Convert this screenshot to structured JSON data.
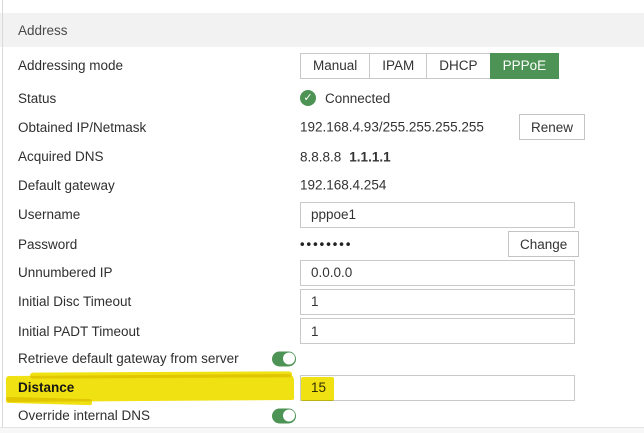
{
  "section_title": "Address",
  "icons": {
    "check": "✓"
  },
  "colors": {
    "green": "#4c9355",
    "highlight_yellow": "#f0e112",
    "header_band": "#f2f2f2"
  },
  "addressing_mode": {
    "label": "Addressing mode",
    "options": [
      "Manual",
      "IPAM",
      "DHCP",
      "PPPoE"
    ],
    "selected": "PPPoE"
  },
  "status": {
    "label": "Status",
    "value": "Connected"
  },
  "obtained_ip": {
    "label": "Obtained IP/Netmask",
    "value": "192.168.4.93/255.255.255.255",
    "button": "Renew"
  },
  "acquired_dns": {
    "label": "Acquired DNS",
    "primary": "8.8.8.8",
    "secondary": "1.1.1.1"
  },
  "default_gateway": {
    "label": "Default gateway",
    "value": "192.168.4.254"
  },
  "username": {
    "label": "Username",
    "value": "pppoe1"
  },
  "password": {
    "label": "Password",
    "masked_value": "••••••••",
    "button": "Change"
  },
  "unnumbered_ip": {
    "label": "Unnumbered IP",
    "value": "0.0.0.0"
  },
  "initial_disc_timeout": {
    "label": "Initial Disc Timeout",
    "value": "1"
  },
  "initial_padt_timeout": {
    "label": "Initial PADT Timeout",
    "value": "1"
  },
  "retrieve_default_gateway": {
    "label": "Retrieve default gateway from server",
    "enabled": true
  },
  "distance": {
    "label": "Distance",
    "value": "15",
    "highlighted": true
  },
  "override_internal_dns": {
    "label": "Override internal DNS",
    "enabled": true
  }
}
